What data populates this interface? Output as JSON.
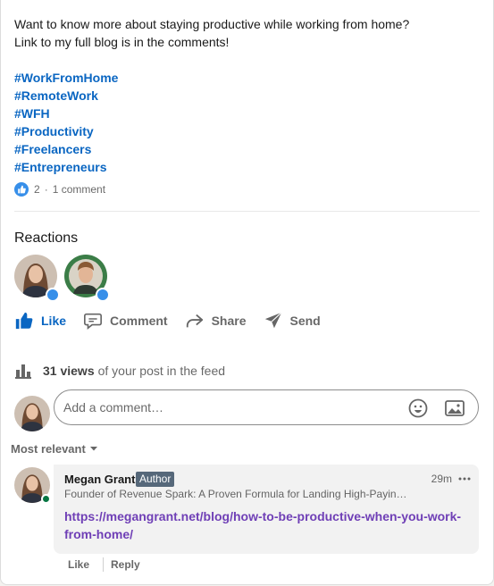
{
  "post": {
    "text_lines": [
      "Want to know more about staying productive while working from home?",
      "Link to my full blog is in the comments!"
    ],
    "hashtags": [
      "#WorkFromHome",
      "#RemoteWork",
      "#WFH",
      "#Productivity",
      "#Freelancers",
      "#Entrepreneurs"
    ],
    "reaction_count": "2",
    "comment_count_text": "1 comment",
    "separator": "·"
  },
  "reactions": {
    "title": "Reactions"
  },
  "actions": {
    "like": "Like",
    "comment": "Comment",
    "share": "Share",
    "send": "Send"
  },
  "views": {
    "count_text": "31 views",
    "suffix": "of your post in the feed"
  },
  "comment_box": {
    "placeholder": "Add a comment…"
  },
  "sort": {
    "label": "Most relevant"
  },
  "comment": {
    "author": "Megan Grant",
    "badge": "Author",
    "time": "29m",
    "headline": "Founder of Revenue Spark: A Proven Formula for Landing High-Payin…",
    "link": "https://megangrant.net/blog/how-to-be-productive-when-you-work-from-home/",
    "like": "Like",
    "reply": "Reply"
  },
  "colors": {
    "accent": "#0a66c2",
    "visited_link": "#6f3fb6",
    "online": "#057642",
    "author_badge": "#56687a"
  },
  "icons": [
    "like-icon",
    "comment-icon",
    "share-icon",
    "send-icon",
    "bar-chart-icon",
    "emoji-icon",
    "image-icon",
    "caret-down-icon",
    "more-icon"
  ]
}
